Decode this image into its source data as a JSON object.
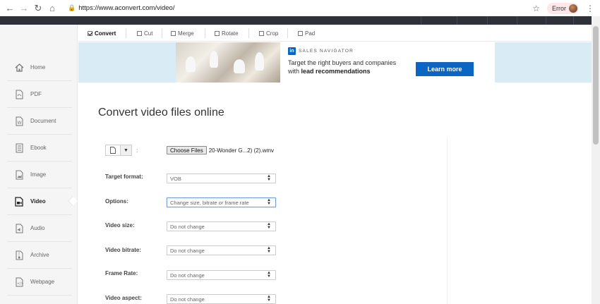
{
  "browser": {
    "url_prefix": "https://",
    "url_host": "www.aconvert.com",
    "url_path": "/video/",
    "error_label": "Error"
  },
  "sidebar": {
    "items": [
      {
        "label": "Home",
        "icon": "home-icon"
      },
      {
        "label": "PDF",
        "icon": "pdf-icon"
      },
      {
        "label": "Document",
        "icon": "document-icon"
      },
      {
        "label": "Ebook",
        "icon": "ebook-icon"
      },
      {
        "label": "Image",
        "icon": "image-icon"
      },
      {
        "label": "Video",
        "icon": "video-icon",
        "active": true
      },
      {
        "label": "Audio",
        "icon": "audio-icon"
      },
      {
        "label": "Archive",
        "icon": "archive-icon"
      },
      {
        "label": "Webpage",
        "icon": "webpage-icon"
      }
    ]
  },
  "tabs": [
    {
      "label": "Convert",
      "active": true
    },
    {
      "label": "Cut"
    },
    {
      "label": "Merge"
    },
    {
      "label": "Rotate"
    },
    {
      "label": "Crop"
    },
    {
      "label": "Pad"
    }
  ],
  "ad": {
    "brand": "SALES NAVIGATOR",
    "line1": "Target the right buyers and companies",
    "line2_prefix": "with ",
    "line2_bold": "lead recommendations",
    "cta": "Learn more"
  },
  "main": {
    "title": "Convert video files online",
    "choose_button": "Choose Files",
    "file_name": "20-Wonder G...2) (2).wmv",
    "fields": [
      {
        "label": "Target format:",
        "value": "VOB"
      },
      {
        "label": "Options:",
        "value": "Change size, bitrate or frame rate",
        "focused": true
      },
      {
        "label": "Video size:",
        "value": "Do not change"
      },
      {
        "label": "Video bitrate:",
        "value": "Do not change"
      },
      {
        "label": "Frame Rate:",
        "value": "Do not change"
      },
      {
        "label": "Video aspect:",
        "value": "Do not change"
      }
    ]
  },
  "colors": {
    "accent_blue": "#0a66c2",
    "ad_background": "#d9ecf6",
    "top_bar": "#2e313a",
    "sidebar_bg": "#f5f5f5"
  }
}
